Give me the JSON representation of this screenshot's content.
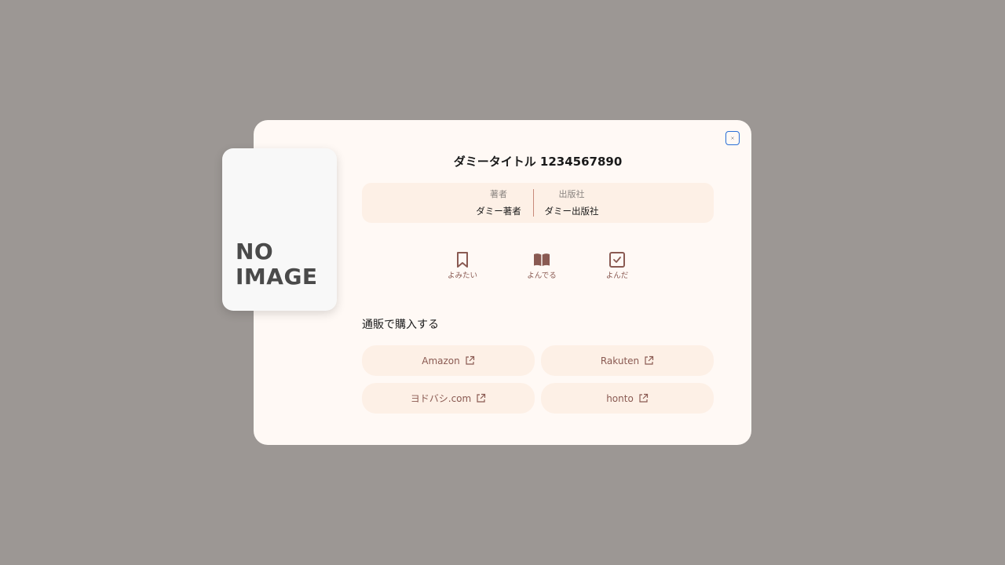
{
  "dialog": {
    "close_icon": "close-icon",
    "cover": {
      "placeholder_text": "NO\nIMAGE"
    },
    "title": "ダミータイトル 1234567890",
    "meta": {
      "author_label": "著者",
      "author_value": "ダミー著者",
      "publisher_label": "出版社",
      "publisher_value": "ダミー出版社"
    },
    "status_buttons": [
      {
        "label": "よみたい",
        "icon": "bookmark-icon"
      },
      {
        "label": "よんでる",
        "icon": "open-book-icon"
      },
      {
        "label": "よんだ",
        "icon": "checkbox-icon"
      }
    ],
    "shop": {
      "heading": "通販で購入する",
      "links": [
        {
          "label": "Amazon",
          "icon": "external-link-icon"
        },
        {
          "label": "Rakuten",
          "icon": "external-link-icon"
        },
        {
          "label": "ヨドバシ.com",
          "icon": "external-link-icon"
        },
        {
          "label": "honto",
          "icon": "external-link-icon"
        }
      ]
    }
  },
  "colors": {
    "overlay": "#9c9794",
    "panel": "#fff9f5",
    "pill": "#fdf0e6",
    "accent": "#8a5a52",
    "focus_ring": "#2a6fd6"
  }
}
